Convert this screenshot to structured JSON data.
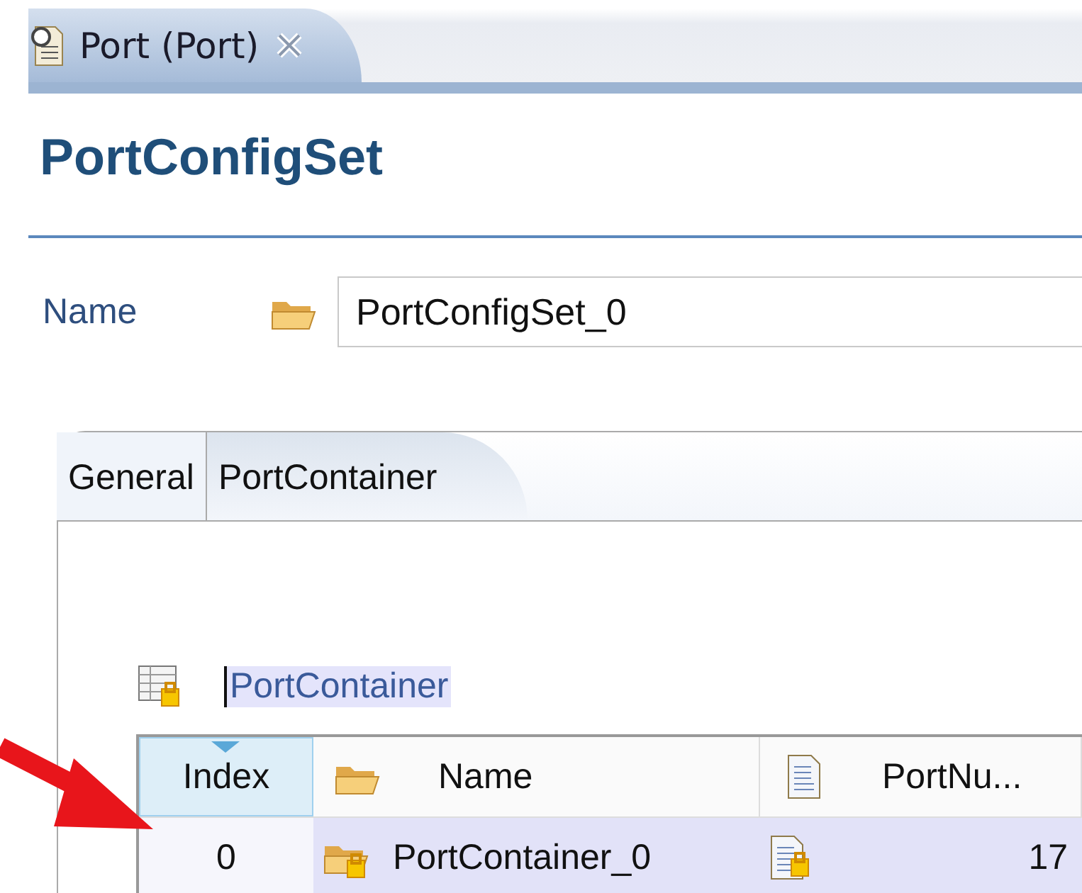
{
  "editor_tab": {
    "label": "Port (Port)"
  },
  "form": {
    "title": "PortConfigSet",
    "name_label": "Name",
    "name_value": "PortConfigSet_0"
  },
  "tabs": [
    {
      "label": "General",
      "selected": false
    },
    {
      "label": "PortContainer",
      "selected": true
    }
  ],
  "table_label": "PortContainer",
  "table": {
    "columns": [
      {
        "label": "Index",
        "kind": "plain",
        "sorted": true
      },
      {
        "label": "Name",
        "kind": "folder",
        "sorted": false
      },
      {
        "label": "PortNu...",
        "kind": "number",
        "sorted": false
      }
    ],
    "rows": [
      {
        "cells": [
          "0",
          "PortContainer_0",
          "17"
        ],
        "selected": true
      }
    ]
  }
}
